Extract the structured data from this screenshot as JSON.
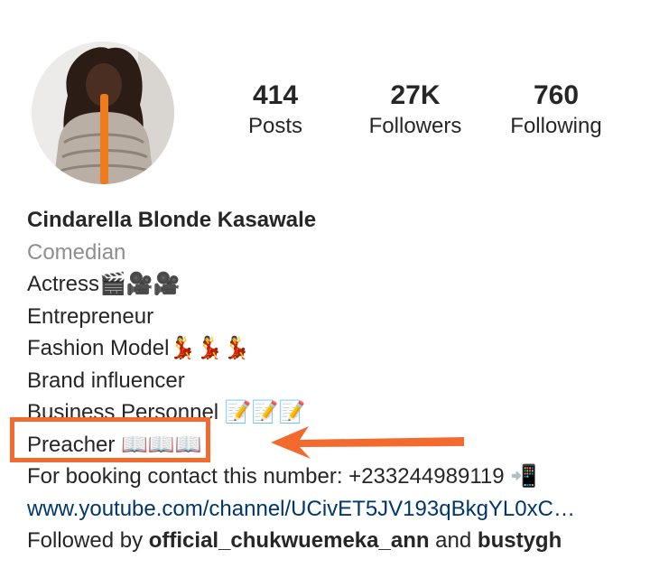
{
  "profile": {
    "avatar_icon": "profile-photo",
    "stats": {
      "posts": {
        "value": "414",
        "label": "Posts"
      },
      "followers": {
        "value": "27K",
        "label": "Followers"
      },
      "following": {
        "value": "760",
        "label": "Following"
      }
    },
    "name": "Cindarella Blonde Kasawale",
    "category": "Comedian",
    "bio_lines": [
      "Actress🎬🎥🎥",
      " Entrepreneur",
      " Fashion Model💃💃💃",
      "Brand influencer",
      "Business Personnel 📝📝📝",
      "Preacher 📖📖📖",
      "For booking contact this number: +233244989119 📲"
    ],
    "link": "www.youtube.com/channel/UCivET5JV193qBkgYL0xC…",
    "followed_by": {
      "prefix": "Followed by ",
      "user1": "official_chukwuemeka_ann",
      "conjunction": " and ",
      "user2": "bustygh"
    }
  },
  "annotation": {
    "highlight_color": "#f26a2e",
    "arrow_icon": "left-arrow"
  }
}
